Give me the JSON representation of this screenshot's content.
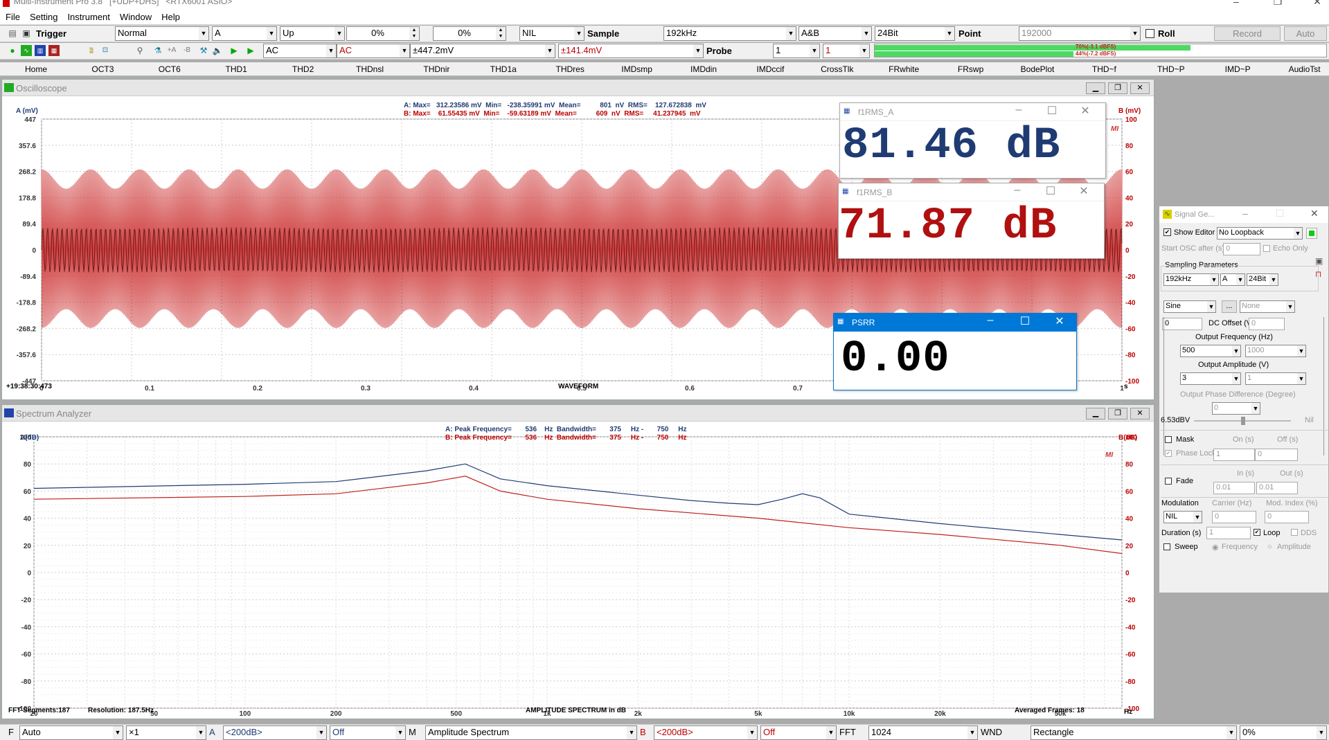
{
  "titlebar": {
    "title": "Multi-Instrument Pro 3.8   [+UDP+DHS]   <RTX6001 ASIO>",
    "min": "–",
    "max": "❐",
    "close": "✕"
  },
  "menu": [
    "File",
    "Setting",
    "Instrument",
    "Window",
    "Help"
  ],
  "toolbar1": {
    "trigger_label": "Trigger",
    "mode": "Normal",
    "channel": "A",
    "edge": "Up",
    "level": "0%",
    "delay": "0%",
    "nil": "NIL",
    "sample_label": "Sample",
    "sample_rate": "192kHz",
    "channels": "A&B",
    "bits": "24Bit",
    "point_label": "Point",
    "points": "192000",
    "roll_label": "Roll",
    "record": "Record",
    "auto": "Auto"
  },
  "toolbar2": {
    "coupling_a": "AC",
    "coupling_b": "AC",
    "range_a": "±447.2mV",
    "range_b": "±141.4mV",
    "probe_label": "Probe",
    "probe_a": "1",
    "probe_b": "1",
    "meter_a": "70%(-3.1 dBFS)",
    "meter_b": "44%(-7.2 dBFS)",
    "meter_a_level": 0.7,
    "meter_b_level": 0.44
  },
  "tabs": [
    "Home",
    "OCT3",
    "OCT6",
    "THD1",
    "THD2",
    "THDnsl",
    "THDnir",
    "THD1a",
    "THDres",
    "IMDsmp",
    "IMDdin",
    "IMDccif",
    "CrossTlk",
    "FRwhite",
    "FRswp",
    "BodePlot",
    "THD~f",
    "THD~P",
    "IMD~P",
    "AudioTst"
  ],
  "oscilloscope": {
    "title": "Oscilloscope",
    "axis_a": "A (mV)",
    "axis_b": "B (mV)",
    "y_left": [
      "447",
      "357.6",
      "268.2",
      "178.8",
      "89.4",
      "0",
      "-89.4",
      "-178.8",
      "-268.2",
      "-357.6",
      "-447"
    ],
    "y_right": [
      "100",
      "80",
      "60",
      "40",
      "20",
      "0",
      "-20",
      "-40",
      "-60",
      "-80",
      "-100"
    ],
    "x_ticks": [
      "0",
      "0.1",
      "0.2",
      "0.3",
      "0.4",
      "0.5",
      "0.6",
      "0.7",
      "1"
    ],
    "x_unit": "s",
    "x_label": "WAVEFORM",
    "timestamp": "+19:38:30:473",
    "info_a": "A: Max=   312.23586 mV  Min=   -238.35991 mV  Mean=          801  nV  RMS=    127.672838  mV",
    "info_b": "B: Max=    61.55435 mV  Min=    -59.63189 mV  Mean=          609  nV  RMS=     41.237945  mV",
    "mi": "MI"
  },
  "spectrum": {
    "title": "Spectrum Analyzer",
    "axis_a": "A(dB)",
    "axis_b": "B(dB)",
    "y_ticks": [
      "100",
      "80",
      "60",
      "40",
      "20",
      "0",
      "-20",
      "-40",
      "-60",
      "-80",
      "-100"
    ],
    "x_ticks": [
      "20",
      "50",
      "100",
      "200",
      "500",
      "1k",
      "2k",
      "5k",
      "10k",
      "20k",
      "50k"
    ],
    "x_unit": "Hz",
    "x_label": "AMPLITUDE SPECTRUM in dB",
    "fft_segments": "FFT Segments:187",
    "resolution": "Resolution: 187.5Hz",
    "averaged": "Averaged Frames: 18",
    "info_a": "A: Peak Frequency=       536    Hz  Bandwidth=       375     Hz -       750     Hz",
    "info_b": "B: Peak Frequency=       536    Hz  Bandwidth=       375     Hz -       750     Hz",
    "mi": "MI"
  },
  "chart_data": [
    {
      "type": "line",
      "title": "Spectrum Analyzer",
      "xlabel": "AMPLITUDE SPECTRUM in dB",
      "ylabel": "A(dB)",
      "y2label": "B(dB)",
      "xscale": "log",
      "xlim": [
        20,
        80000
      ],
      "ylim": [
        -100,
        100
      ],
      "series": [
        {
          "name": "A",
          "color": "#1f3b73",
          "x": [
            20,
            100,
            200,
            400,
            536,
            700,
            1000,
            2000,
            3000,
            4000,
            5000,
            6000,
            7000,
            8000,
            10000,
            20000,
            50000,
            80000
          ],
          "y": [
            62,
            65,
            67,
            75,
            80,
            69,
            64,
            57,
            53,
            51,
            50,
            54,
            58,
            55,
            43,
            36,
            28,
            24
          ]
        },
        {
          "name": "B",
          "color": "#c02020",
          "x": [
            20,
            100,
            200,
            400,
            536,
            700,
            1000,
            2000,
            5000,
            10000,
            20000,
            50000,
            80000
          ],
          "y": [
            54,
            56,
            58,
            66,
            71,
            60,
            54,
            47,
            40,
            33,
            28,
            20,
            14
          ]
        }
      ]
    },
    {
      "type": "line",
      "title": "Oscilloscope",
      "xlabel": "WAVEFORM",
      "ylabel": "A (mV)",
      "y2label": "B (mV)",
      "xlim": [
        0,
        1
      ],
      "ylim": [
        -447,
        447
      ],
      "y2lim": [
        -100,
        100
      ],
      "series": [
        {
          "name": "A",
          "color": "#5a1010",
          "max": 312.23586,
          "min": -238.35991,
          "rms": 127.672838
        },
        {
          "name": "B",
          "color": "#d04040",
          "max": 61.55435,
          "min": -59.63189,
          "rms": 41.237945
        }
      ]
    }
  ],
  "f1rms_a": {
    "title": "f1RMS_A",
    "value": "81.46 dB",
    "color": "#1f3b73"
  },
  "f1rms_b": {
    "title": "f1RMS_B",
    "value": "71.87 dB",
    "color": "#b01010"
  },
  "psrr": {
    "title": "PSRR",
    "value": "0.00"
  },
  "siggen": {
    "title": "Signal Ge...",
    "show_editor": "Show Editor",
    "loopback": "No Loopback",
    "start_osc": "Start OSC after (s)",
    "start_osc_val": "0",
    "echo_only": "Echo Only",
    "sampling_params": "Sampling Parameters",
    "rate": "192kHz",
    "channel": "A",
    "bits": "24Bit",
    "waveform": "Sine",
    "dots": "...",
    "none": "None",
    "dc_offset": "DC Offset (V)",
    "dc_val": "0",
    "dc_val2": "0",
    "out_freq": "Output Frequency (Hz)",
    "freq": "500",
    "freq2": "1000",
    "out_amp": "Output Amplitude (V)",
    "amp": "3",
    "amp2": "1",
    "phase_diff": "Output Phase Difference (Degree)",
    "phase": "0",
    "level_dbv": "6.53dBV",
    "nil": "Nil",
    "mask": "Mask",
    "on_s": "On (s)",
    "off_s": "Off (s)",
    "phase_lock": "Phase Lock",
    "on_val": "1",
    "off_val": "0",
    "fade": "Fade",
    "in_s": "In (s)",
    "out_s": "Out (s)",
    "in_val": "0.01",
    "out_val": "0.01",
    "modulation": "Modulation",
    "carrier": "Carrier (Hz)",
    "mod_index": "Mod. Index (%)",
    "mod_sel": "NIL",
    "carrier_val": "0",
    "mod_val": "0",
    "duration": "Duration (s)",
    "duration_val": "1",
    "loop": "Loop",
    "dds": "DDS",
    "sweep": "Sweep",
    "frequency": "Frequency",
    "amplitude": "Amplitude"
  },
  "bottom": {
    "f_label": "F",
    "f_mode": "Auto",
    "zoom": "×1",
    "a_label": "A",
    "a_floor": "<200dB>",
    "a_off": "Off",
    "m_label": "M",
    "m_mode": "Amplitude Spectrum",
    "b_label": "B",
    "b_floor": "<200dB>",
    "b_off": "Off",
    "fft_label": "FFT",
    "fft_size": "1024",
    "wnd_label": "WND",
    "window": "Rectangle",
    "overlap": "0%"
  }
}
